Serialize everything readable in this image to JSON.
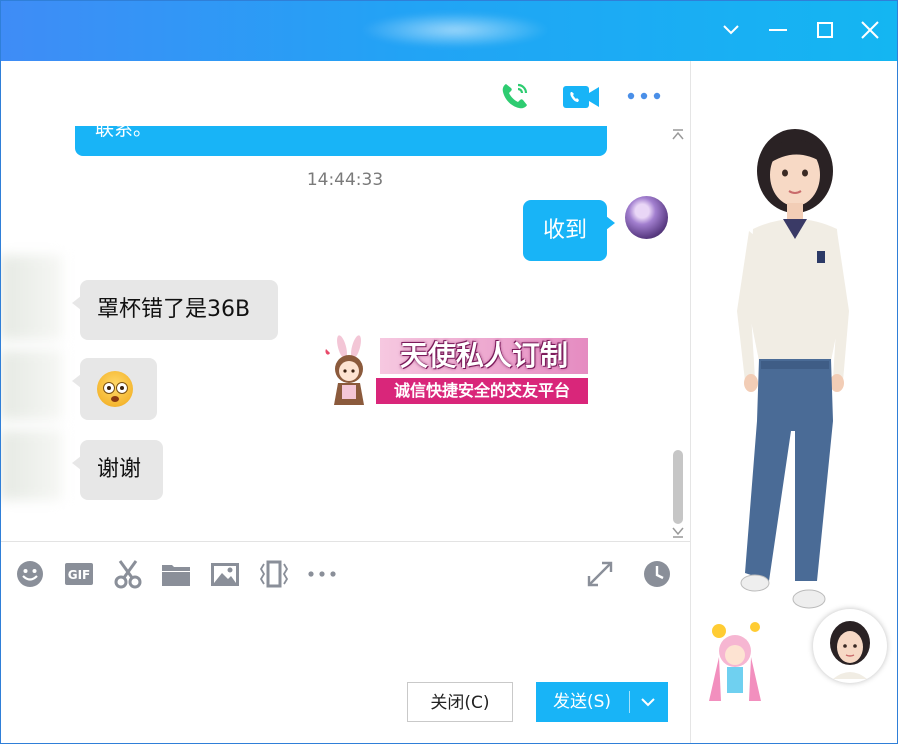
{
  "window": {
    "controls": [
      "chevron-down-icon",
      "minimize-icon",
      "maximize-icon",
      "close-icon"
    ]
  },
  "header": {
    "icons": [
      "phone-call-icon",
      "video-call-icon",
      "more-icon"
    ]
  },
  "messages": {
    "top_bubble_text": "联系。",
    "timestamp": "14:44:33",
    "sent": [
      {
        "text": "收到"
      }
    ],
    "received": [
      {
        "text": "罩杯错了是36B"
      },
      {
        "emoji": "shocked-face-emoji"
      },
      {
        "text": "谢谢"
      }
    ]
  },
  "banner": {
    "title": "天使私人订制",
    "subtitle": "诚信快捷安全的交友平台"
  },
  "toolbar": {
    "tools": [
      "emoji-icon",
      "gif-icon",
      "scissors-icon",
      "folder-icon",
      "image-icon",
      "shake-window-icon",
      "more-icon"
    ],
    "right_tools": [
      "expand-icon",
      "history-icon"
    ]
  },
  "buttons": {
    "close_label": "关闭(C)",
    "send_label": "发送(S)"
  },
  "colors": {
    "titlebar_start": "#3f8cf6",
    "titlebar_end": "#14b6f2",
    "bubble_sent": "#18b4f7",
    "bubble_received": "#e7e7e7",
    "call_icon": "#2ecc71",
    "video_icon": "#18b4f7",
    "toolbar_icon": "#8a8f99"
  }
}
